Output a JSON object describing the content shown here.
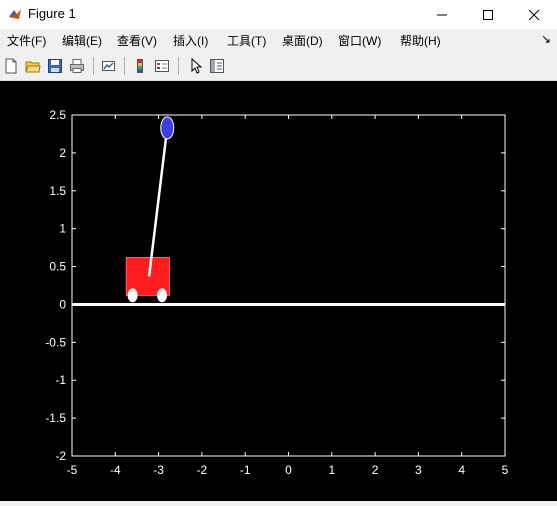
{
  "window": {
    "title": "Figure 1"
  },
  "menu": {
    "items": [
      "文件(F)",
      "编辑(E)",
      "查看(V)",
      "插入(I)",
      "工具(T)",
      "桌面(D)",
      "窗口(W)",
      "帮助(H)"
    ],
    "overflow_glyph": "↘"
  },
  "toolbar": {
    "icons": [
      "new-figure-icon",
      "open-icon",
      "save-icon",
      "print-icon",
      "link-plot-icon",
      "colorbar-icon",
      "legend-icon",
      "pointer-icon",
      "property-inspector-icon"
    ]
  },
  "plot": {
    "background": "#000000",
    "foreground": "#ffffff",
    "xlim": [
      -5,
      5
    ],
    "ylim": [
      -2,
      2.5
    ],
    "xticks": [
      "-5",
      "-4",
      "-3",
      "-2",
      "-1",
      "0",
      "1",
      "2",
      "3",
      "4",
      "5"
    ],
    "yticks": [
      "-2",
      "-1.5",
      "-1",
      "-0.5",
      "0",
      "0.5",
      "1",
      "1.5",
      "2",
      "2.5"
    ],
    "track": {
      "y": 0,
      "color": "#ffffff"
    },
    "cart": {
      "x_left": -3.75,
      "x_right": -2.75,
      "y_bottom": 0.12,
      "y_top": 0.62,
      "color": "#ff1c1c"
    },
    "wheels": [
      {
        "x": -3.6,
        "y": 0.12
      },
      {
        "x": -2.92,
        "y": 0.12
      }
    ],
    "pendulum": {
      "pivot_x": -3.22,
      "pivot_y": 0.37,
      "tip_x": -2.8,
      "tip_y": 2.33,
      "color": "#ffffff"
    },
    "bob": {
      "x": -2.8,
      "y": 2.33,
      "color": "#3d3de6"
    }
  }
}
